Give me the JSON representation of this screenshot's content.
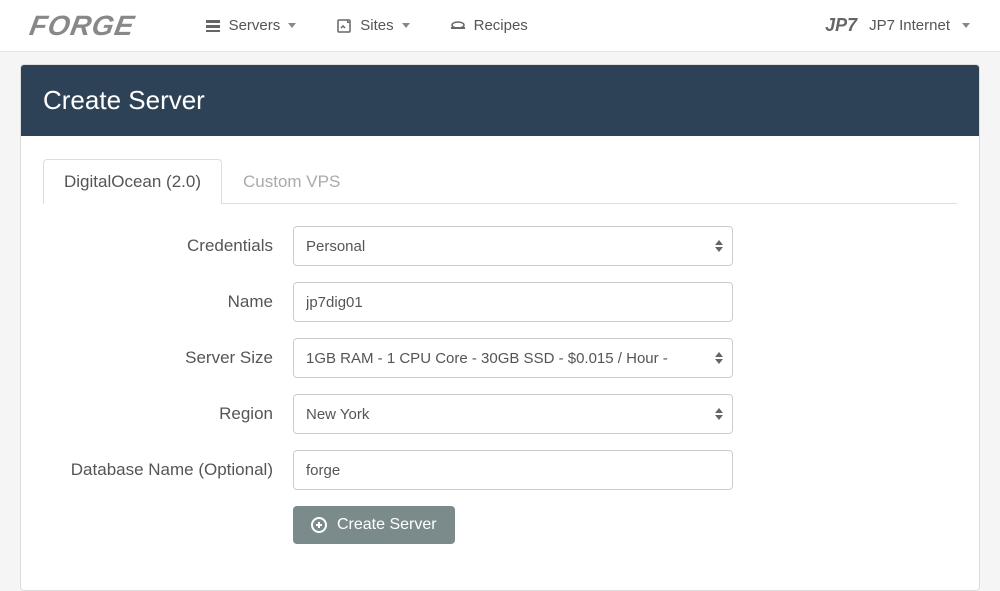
{
  "logo": "FORGE",
  "nav": {
    "servers": "Servers",
    "sites": "Sites",
    "recipes": "Recipes"
  },
  "account": {
    "brand": "JP7",
    "name": "JP7 Internet"
  },
  "page": {
    "title": "Create Server"
  },
  "tabs": {
    "do": "DigitalOcean (2.0)",
    "custom": "Custom VPS"
  },
  "form": {
    "credentials": {
      "label": "Credentials",
      "value": "Personal"
    },
    "name": {
      "label": "Name",
      "value": "jp7dig01"
    },
    "size": {
      "label": "Server Size",
      "value": "1GB RAM - 1 CPU Core - 30GB SSD - $0.015 / Hour -"
    },
    "region": {
      "label": "Region",
      "value": "New York"
    },
    "database": {
      "label": "Database Name (Optional)",
      "value": "forge"
    },
    "submit": "Create Server"
  }
}
